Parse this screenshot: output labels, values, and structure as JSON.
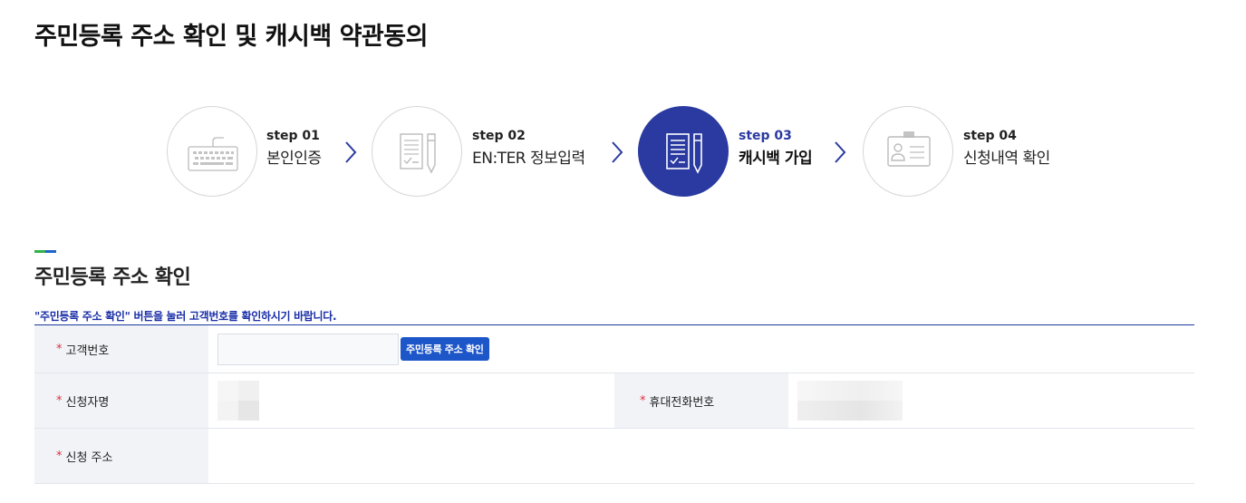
{
  "page": {
    "title": "주민등록 주소 확인 및 캐시백 약관동의"
  },
  "steps": [
    {
      "no": "step 01",
      "name": "본인인증",
      "icon": "keyboard-icon",
      "active": false
    },
    {
      "no": "step 02",
      "name": "EN:TER 정보입력",
      "icon": "document-pencil-icon",
      "active": false
    },
    {
      "no": "step 03",
      "name": "캐시백 가입",
      "icon": "document-pencil-icon",
      "active": true
    },
    {
      "no": "step 04",
      "name": "신청내역 확인",
      "icon": "id-card-icon",
      "active": false
    }
  ],
  "colors": {
    "active": "#2a3aa0",
    "required": "#e0303a",
    "button": "#1d56c9",
    "notice": "#1a2fa8"
  },
  "section": {
    "title": "주민등록 주소 확인",
    "notice": "\"주민등록 주소 확인\" 버튼을 눌러 고객번호를 확인하시기 바랍니다."
  },
  "form": {
    "required_mark": "*",
    "customer_no_label": "고객번호",
    "customer_no_value": "",
    "verify_button": "주민등록 주소 확인",
    "applicant_name_label": "신청자명",
    "mobile_label": "휴대전화번호",
    "address_label": "신청 주소"
  }
}
